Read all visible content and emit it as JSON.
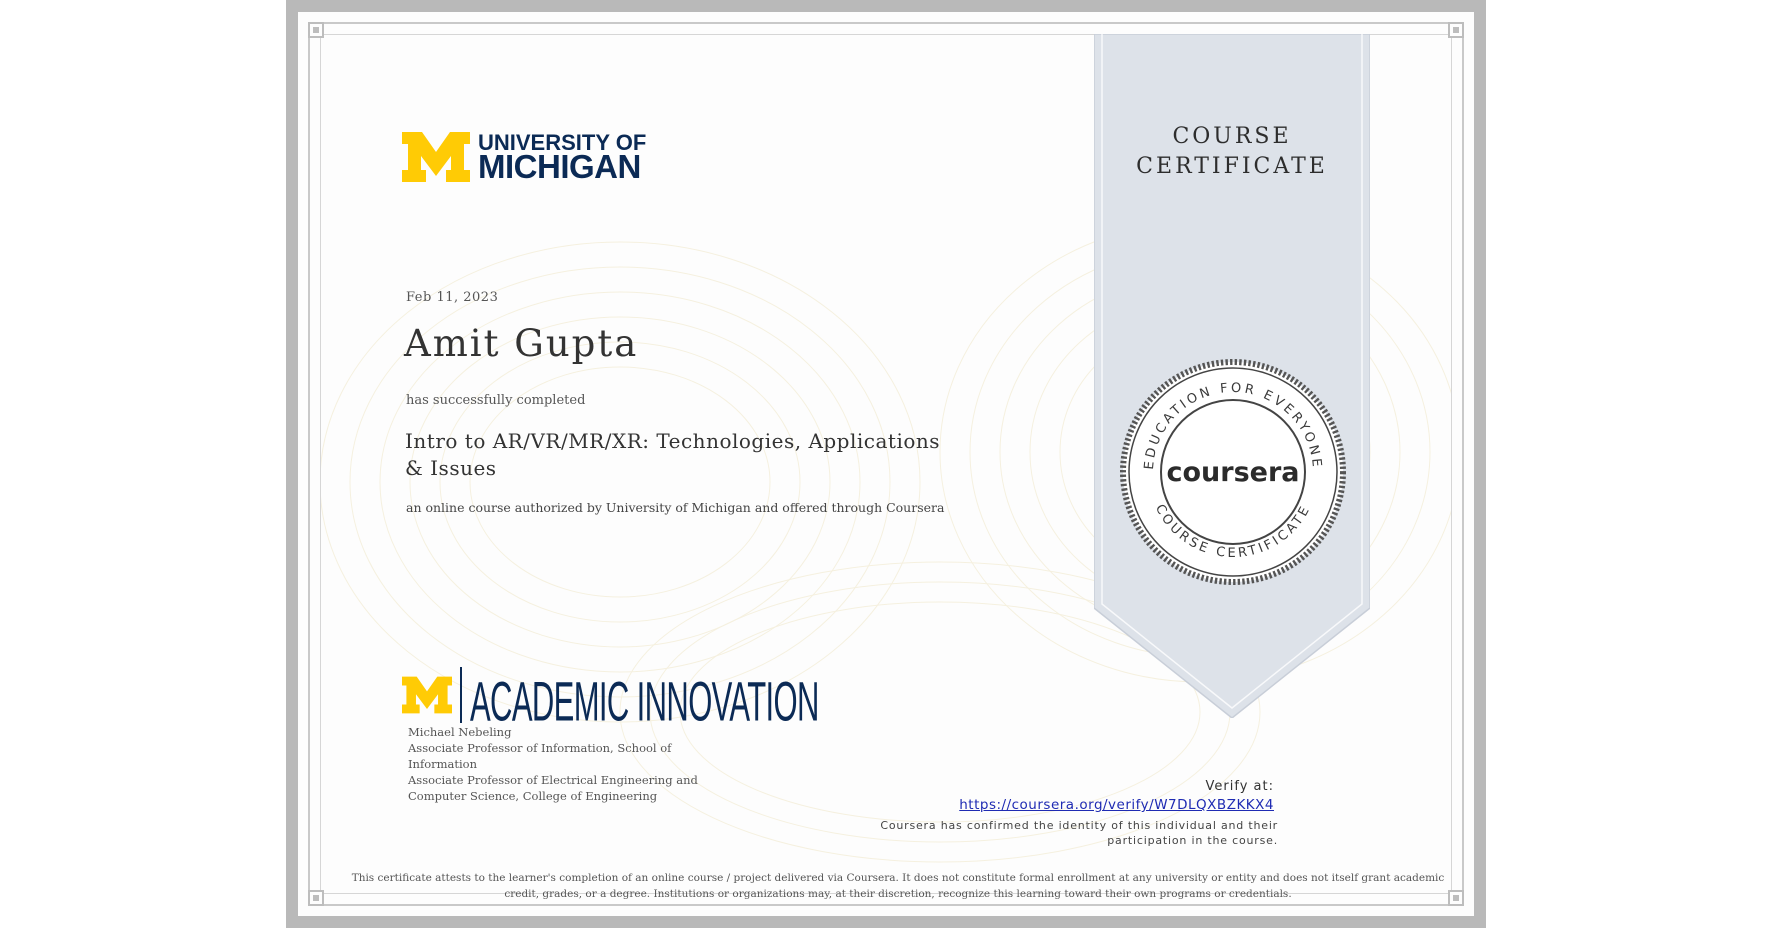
{
  "ribbon": {
    "title_line1": "COURSE",
    "title_line2": "CERTIFICATE"
  },
  "seal": {
    "brand": "coursera",
    "ring_text_top": "EDUCATION FOR EVERYONE",
    "ring_text_bottom": "COURSE CERTIFICATE"
  },
  "issuer_logo": {
    "line1": "UNIVERSITY OF",
    "line2": "MICHIGAN"
  },
  "certificate": {
    "date": "Feb 11, 2023",
    "recipient": "Amit Gupta",
    "completed_text": "has successfully completed",
    "course_title": "Intro to AR/VR/MR/XR: Technologies, Applications & Issues",
    "authorized_text": "an online course authorized by University of Michigan and offered through Coursera"
  },
  "partner_logo": {
    "text": "ACADEMIC INNOVATION"
  },
  "signer": {
    "name": "Michael Nebeling",
    "title1": "Associate Professor of Information, School of Information",
    "title2": "Associate Professor of Electrical Engineering and Computer Science, College of Engineering"
  },
  "verify": {
    "label": "Verify at:",
    "url": "https://coursera.org/verify/W7DLQXBZKKX4",
    "confirm_text": "Coursera has confirmed the identity of this individual and their participation in the course."
  },
  "disclaimer": "This certificate attests to the learner's completion of an online course / project delivered via Coursera. It does not constitute formal enrollment at any university or entity and does not itself grant academic credit, grades, or a degree. Institutions or organizations may, at their discretion, recognize this learning toward their own programs or credentials.",
  "colors": {
    "maize": "#FFCB05",
    "michigan_blue": "#0B2A55",
    "ribbon": "#DCE1E8",
    "link": "#1F2BB3"
  }
}
